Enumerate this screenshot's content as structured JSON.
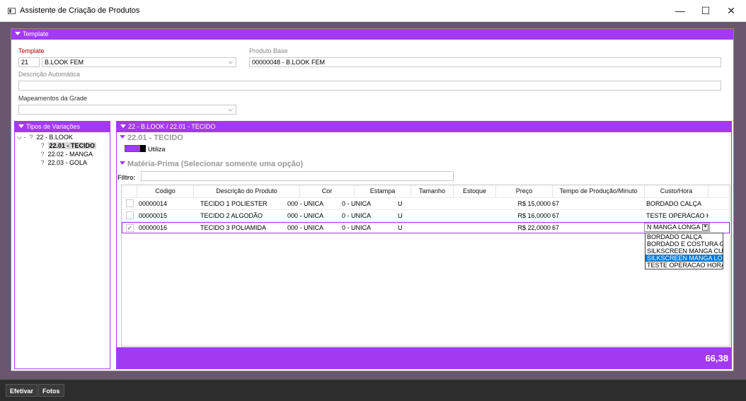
{
  "window": {
    "title": "Assistente de Criação de Produtos",
    "minimize": "—",
    "maximize": "☐",
    "close": "✕"
  },
  "template_section": {
    "header": "Template",
    "template_label": "Template",
    "template_code": "21",
    "template_name": "B.LOOK FEM",
    "produto_base_label": "Produto Base",
    "produto_base_value": "00000048 - B.LOOK FEM",
    "descricao_label": "Descrição Automática",
    "descricao_value": "",
    "mapeamentos_label": "Mapeamentos da Grade",
    "mapeamentos_value": ""
  },
  "tipos_variacoes": {
    "header": "Tipos de Variações",
    "root": "22 - B.LOOK",
    "children": [
      "22.01 - TECIDO",
      "22.02 - MANGA",
      "22.03 - GOLA"
    ]
  },
  "detail": {
    "header": "22 - B.LOOK / 22.01 - TECIDO",
    "section_title": "22.01 - TECIDO",
    "utiliza_label": "Utiliza",
    "materia_prima_title": "Matéria-Prima (Selecionar somente uma opção)",
    "filtro_label": "Filtro:",
    "filtro_value": ""
  },
  "grid": {
    "columns": [
      "Código",
      "Descrição do Produto",
      "Cor",
      "Estampa",
      "Tamanho",
      "Estoque",
      "Preço",
      "Tempo de Produção/Minuto",
      "Custo/Hora"
    ],
    "rows": [
      {
        "checked": "",
        "codigo": "00000014",
        "descricao": "TECIDO 1 POLIESTER",
        "cor": "000 - UNICA",
        "estampa": "0 - UNICA",
        "tamanho": "U",
        "estoque": "",
        "preco": "R$ 15,0000",
        "tempo": "67",
        "custo": "BORDADO CALÇA"
      },
      {
        "checked": "",
        "codigo": "00000015",
        "descricao": "TECIDO 2 ALGODÃO",
        "cor": "000 - UNICA",
        "estampa": "0 - UNICA",
        "tamanho": "U",
        "estoque": "",
        "preco": "R$ 16,0000",
        "tempo": "67",
        "custo": "TESTE OPERACAO H..."
      },
      {
        "checked": "✓",
        "codigo": "00000016",
        "descricao": "TECIDO 3 POLIAMIDA",
        "cor": "000 - UNICA",
        "estampa": "0 - UNICA",
        "tamanho": "U",
        "estoque": "",
        "preco": "R$ 22,0000",
        "tempo": "67",
        "custo": "N MANGA LONGA"
      }
    ],
    "dropdown_options": [
      "BORDADO CALÇA",
      "BORDADO E COSTURA GOL",
      "SILKSCREEN MANGA CURTA",
      "SILKSCREEN MANGA LONGA",
      "TESTE OPERACAO HORA"
    ],
    "dropdown_highlighted_index": 3,
    "total": "66,38"
  },
  "bottom_buttons": {
    "efetivar": "Efetivar",
    "fotos": "Fotos"
  },
  "colors": {
    "accent": "#a23af2",
    "frame": "#6b5670"
  }
}
